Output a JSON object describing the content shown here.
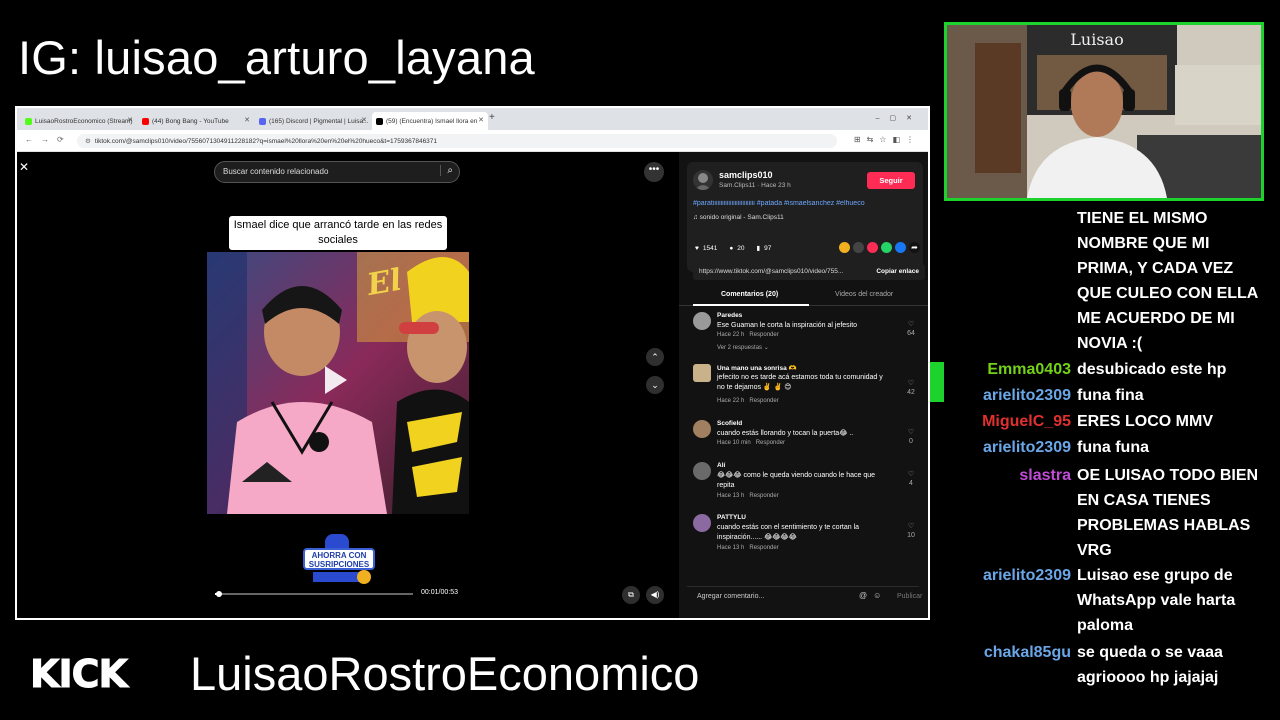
{
  "overlay": {
    "ig_handle": "IG: luisao_arturo_layana",
    "kick_logo": "KICK",
    "channel_name": "LuisaoRostroEconomico"
  },
  "browser": {
    "tabs": [
      {
        "label": "LuisaoRostroEconomico (Stream)",
        "icon": "kick-icon",
        "color": "#53fc18"
      },
      {
        "label": "(44) Bong Bang - YouTube",
        "icon": "youtube-icon",
        "color": "#ff0000"
      },
      {
        "label": "(165) Discord | Pigmental | Luisa...",
        "icon": "discord-icon",
        "color": "#5865f2"
      },
      {
        "label": "(59) (Encuentra) Ismael llora en",
        "icon": "tiktok-icon",
        "color": "#000000"
      }
    ],
    "url": "tiktok.com/@samclips010/video/7556071304911228182?q=ismael%20llora%20en%20el%20hueco&t=1759367846371"
  },
  "video": {
    "search_placeholder": "Buscar contenido relacionado",
    "caption": "Ismael dice que arrancó tarde en las redes sociales",
    "promo_line1": "AHORRA CON",
    "promo_line2": "SUSRIPCIONES",
    "time": "00:01/00:53",
    "progress": 0.02
  },
  "creator": {
    "username": "samclips010",
    "subline": "Sam.Clips11 · Hace 23 h",
    "follow_label": "Seguir",
    "hashtags": "#paratiiiiiiiiiiiiiiiiiiiiiiiiiii #patada #ismaelsanchez #elhueco",
    "sound": "♫ sonido original - Sam.Clips11",
    "likes": "1541",
    "comments": "20",
    "saves": "97",
    "link": "https://www.tiktok.com/@samclips010/video/755...",
    "copy_label": "Copiar enlace"
  },
  "panel_tabs": {
    "comments": "Comentarios (20)",
    "videos": "Videos del creador"
  },
  "comments": [
    {
      "user": "Paredes",
      "text": "Ese Guaman le corta la inspiración al jefesito",
      "time": "Hace 22 h",
      "reply": "Responder",
      "likes": "64",
      "replies": "Ver 2 respuestas ⌄"
    },
    {
      "user": "Una mano una sonrisa 🫶",
      "text": "jefecito no es tarde acá estamos toda tu comunidad y no te dejamos ✌️ ✌️ 😊",
      "time": "Hace 22 h",
      "reply": "Responder",
      "likes": "42"
    },
    {
      "user": "Scofield",
      "text": "cuando estás llorando y tocan la puerta😂 ..",
      "time": "Hace 10 min",
      "reply": "Responder",
      "likes": "0"
    },
    {
      "user": "Alí",
      "text": "😂😂😂 como le queda viendo cuando le hace que repita",
      "time": "Hace 13 h",
      "reply": "Responder",
      "likes": "4"
    },
    {
      "user": "PATTYLU",
      "text": "cuando estás con el sentimiento y te cortan la inspiración...... 😂😂😂😂",
      "time": "Hace 13 h",
      "reply": "Responder",
      "likes": "10"
    }
  ],
  "add_comment": {
    "placeholder": "Agregar comentario...",
    "publish": "Publicar"
  },
  "chat": [
    {
      "user": "",
      "color": "#ffffff",
      "msg": "TIENE EL MISMO NOMBRE QUE MI PRIMA, Y CADA VEZ QUE CULEO CON ELLA ME ACUERDO DE MI NOVIA :("
    },
    {
      "user": "Emma0403",
      "color": "#73d216",
      "msg": "desubicado este hp"
    },
    {
      "user": "arielito2309",
      "color": "#6aa7e8",
      "msg": "funa fina"
    },
    {
      "user": "MiguelC_95",
      "color": "#e03030",
      "msg": "ERES LOCO MMV"
    },
    {
      "user": "arielito2309",
      "color": "#6aa7e8",
      "msg": "funa funa"
    },
    {
      "user": "slastra",
      "color": "#c04bd6",
      "msg": "OE LUISAO TODO BIEN EN CASA TIENES PROBLEMAS HABLAS VRG"
    },
    {
      "user": "arielito2309",
      "color": "#6aa7e8",
      "msg": "Luisao ese grupo de WhatsApp vale harta paloma"
    },
    {
      "user": "chakal85gu",
      "color": "#6aa7e8",
      "msg": "se queda o se vaaa agrioooo hp jajajaj"
    }
  ],
  "webcam": {
    "poster_text": "Luisao"
  }
}
